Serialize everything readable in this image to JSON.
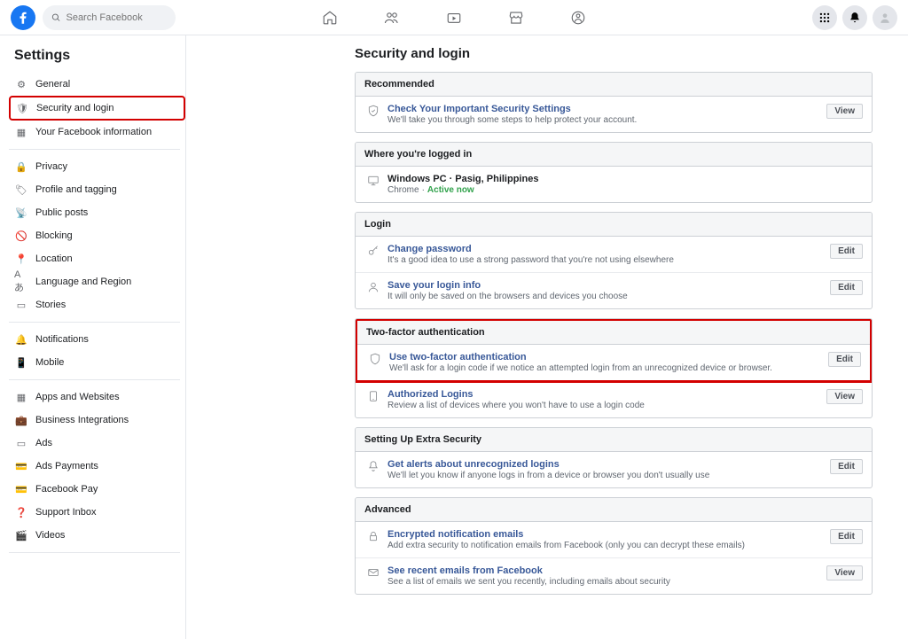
{
  "search": {
    "placeholder": "Search Facebook"
  },
  "sidebar": {
    "heading": "Settings",
    "items": [
      {
        "label": "General"
      },
      {
        "label": "Security and login"
      },
      {
        "label": "Your Facebook information"
      },
      {
        "label": "Privacy"
      },
      {
        "label": "Profile and tagging"
      },
      {
        "label": "Public posts"
      },
      {
        "label": "Blocking"
      },
      {
        "label": "Location"
      },
      {
        "label": "Language and Region"
      },
      {
        "label": "Stories"
      },
      {
        "label": "Notifications"
      },
      {
        "label": "Mobile"
      },
      {
        "label": "Apps and Websites"
      },
      {
        "label": "Business Integrations"
      },
      {
        "label": "Ads"
      },
      {
        "label": "Ads Payments"
      },
      {
        "label": "Facebook Pay"
      },
      {
        "label": "Support Inbox"
      },
      {
        "label": "Videos"
      }
    ]
  },
  "page": {
    "title": "Security and login",
    "sections": {
      "recommended": {
        "heading": "Recommended",
        "row": {
          "title": "Check Your Important Security Settings",
          "desc": "We'll take you through some steps to help protect your account.",
          "action": "View"
        }
      },
      "where": {
        "heading": "Where you're logged in",
        "row": {
          "device": "Windows PC",
          "location": "Pasig, Philippines",
          "browser": "Chrome",
          "status": "Active now"
        }
      },
      "login": {
        "heading": "Login",
        "rows": [
          {
            "title": "Change password",
            "desc": "It's a good idea to use a strong password that you're not using elsewhere",
            "action": "Edit"
          },
          {
            "title": "Save your login info",
            "desc": "It will only be saved on the browsers and devices you choose",
            "action": "Edit"
          }
        ]
      },
      "twofa": {
        "heading": "Two-factor authentication",
        "rows": [
          {
            "title": "Use two-factor authentication",
            "desc": "We'll ask for a login code if we notice an attempted login from an unrecognized device or browser.",
            "action": "Edit"
          },
          {
            "title": "Authorized Logins",
            "desc": "Review a list of devices where you won't have to use a login code",
            "action": "View"
          }
        ]
      },
      "extra": {
        "heading": "Setting Up Extra Security",
        "row": {
          "title": "Get alerts about unrecognized logins",
          "desc": "We'll let you know if anyone logs in from a device or browser you don't usually use",
          "action": "Edit"
        }
      },
      "advanced": {
        "heading": "Advanced",
        "rows": [
          {
            "title": "Encrypted notification emails",
            "desc": "Add extra security to notification emails from Facebook (only you can decrypt these emails)",
            "action": "Edit"
          },
          {
            "title": "See recent emails from Facebook",
            "desc": "See a list of emails we sent you recently, including emails about security",
            "action": "View"
          }
        ]
      }
    }
  }
}
